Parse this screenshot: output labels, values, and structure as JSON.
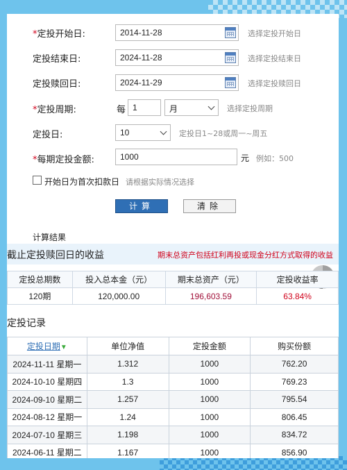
{
  "form": {
    "start_date": {
      "required": "*",
      "label": "定投开始日:",
      "value": "2014-11-28",
      "hint": "选择定投开始日"
    },
    "end_date": {
      "label": "定投结束日:",
      "value": "2024-11-28",
      "hint": "选择定投结束日"
    },
    "redeem_date": {
      "label": "定投赎回日:",
      "value": "2024-11-29",
      "hint": "选择定投赎回日"
    },
    "period": {
      "required": "*",
      "label": "定投周期:",
      "prefix": "每",
      "count": "1",
      "unit": "月",
      "hint": "选择定投周期"
    },
    "day": {
      "label": "定投日:",
      "value": "10",
      "hint": "定投日1~28或周一~周五"
    },
    "amount": {
      "required": "*",
      "label": "每期定投金额:",
      "value": "1000",
      "unit": "元",
      "hint": "例如：500"
    },
    "first_debit": {
      "label": "开始日为首次扣款日",
      "hint": "请根据实际情况选择"
    },
    "calc_button": "计算",
    "clear_button": "清除"
  },
  "results": {
    "section_label": "计算结果",
    "title": "截止定投赎回日的收益",
    "note": "期末总资产包括红利再投或现金分红方式取得的收益",
    "headers": [
      "定投总期数",
      "投入总本金（元）",
      "期末总资产（元）",
      "定投收益率"
    ],
    "values": [
      "120期",
      "120,000.00",
      "196,603.59",
      "63.84%"
    ]
  },
  "records": {
    "title": "定投记录",
    "headers": [
      "定投日期",
      "单位净值",
      "定投金额",
      "购买份额"
    ],
    "sort_icon": "down-arrow",
    "rows": [
      [
        "2024-11-11 星期一",
        "1.312",
        "1000",
        "762.20"
      ],
      [
        "2024-10-10 星期四",
        "1.3",
        "1000",
        "769.23"
      ],
      [
        "2024-09-10 星期二",
        "1.257",
        "1000",
        "795.54"
      ],
      [
        "2024-08-12 星期一",
        "1.24",
        "1000",
        "806.45"
      ],
      [
        "2024-07-10 星期三",
        "1.198",
        "1000",
        "834.72"
      ],
      [
        "2024-06-11 星期二",
        "1.167",
        "1000",
        "856.90"
      ]
    ]
  },
  "colors": {
    "accent": "#2f6fb5",
    "highlight": "#d0021b",
    "background": "#6ec3ec"
  }
}
